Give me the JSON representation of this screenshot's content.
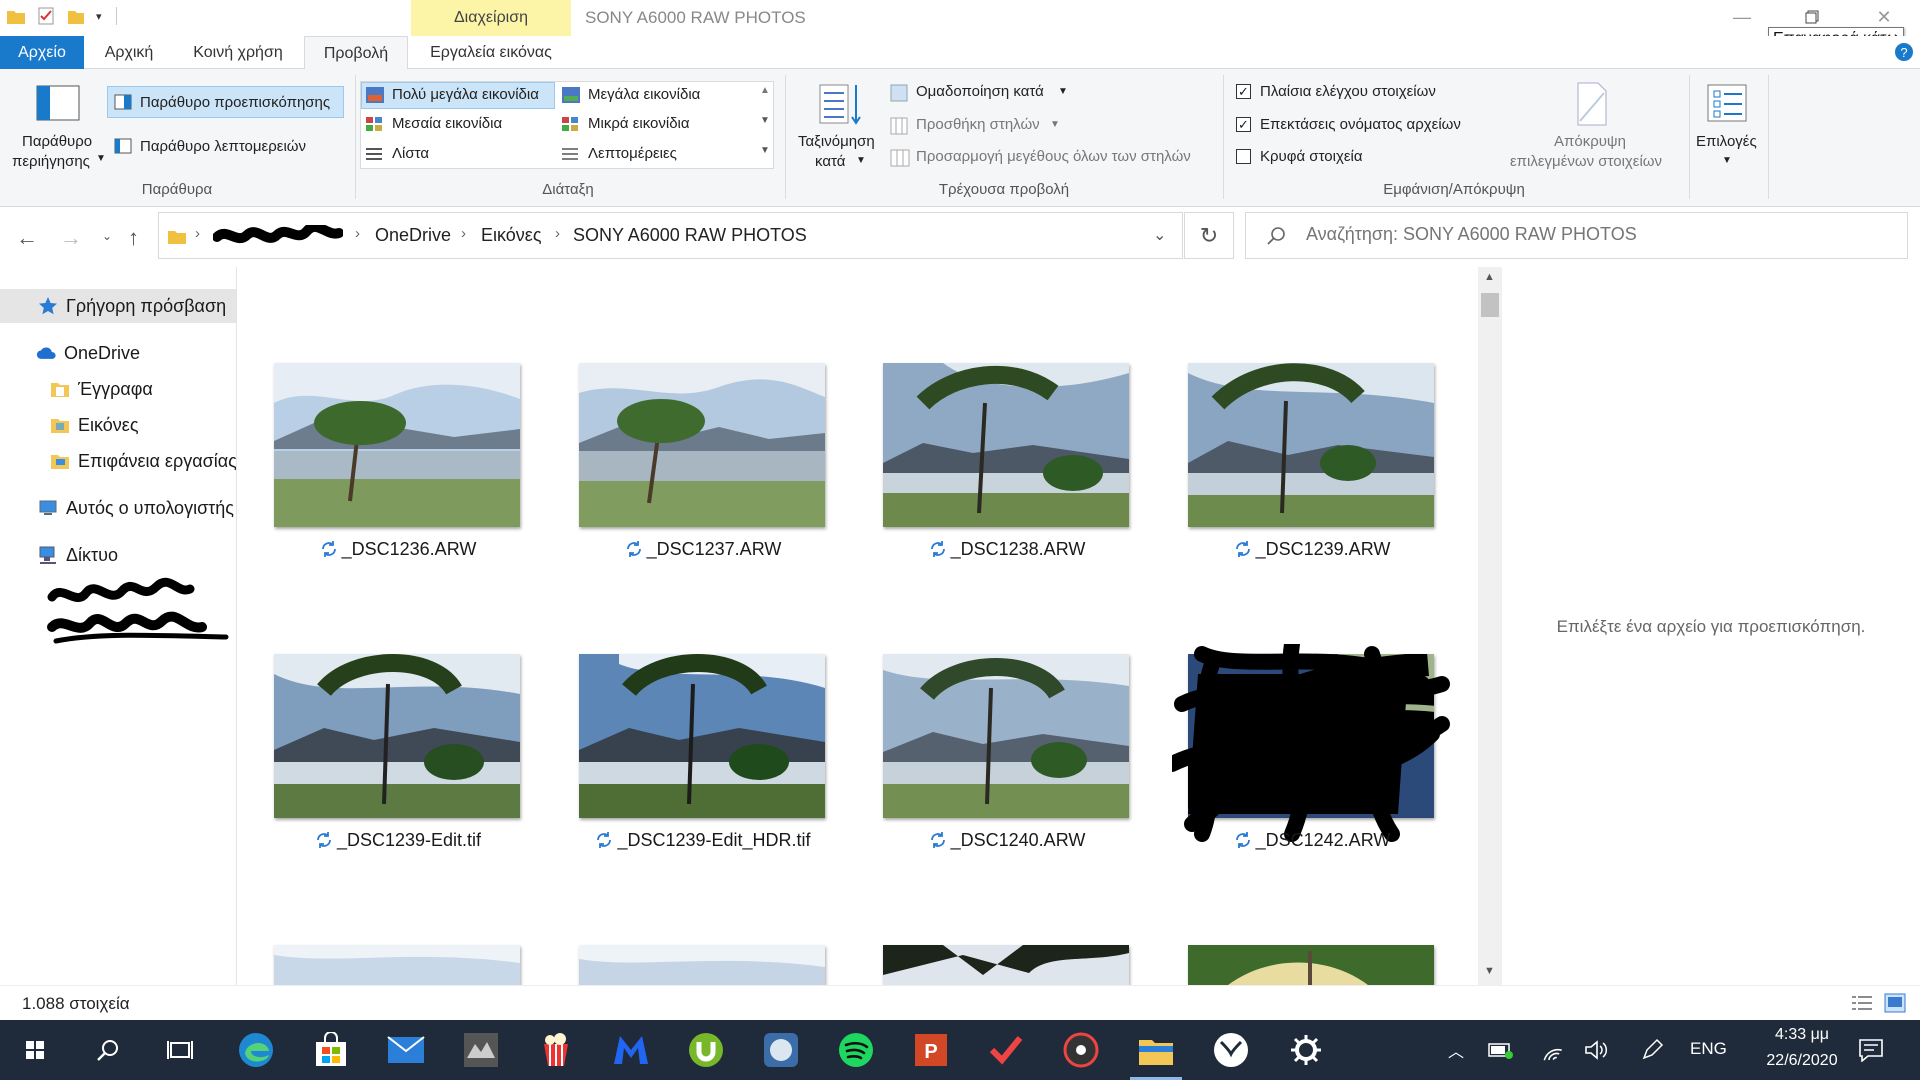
{
  "window": {
    "title": "SONY A6000 RAW PHOTOS",
    "context_tab_header": "Διαχείριση",
    "tooltip": "Επαναφορά κάτω"
  },
  "tabs": {
    "file": "Αρχείο",
    "home": "Αρχική",
    "share": "Κοινή χρήση",
    "view": "Προβολή",
    "image_tools": "Εργαλεία εικόνας"
  },
  "ribbon": {
    "panes": {
      "label": "Παράθυρα",
      "nav_pane": "Παράθυρο",
      "nav_pane_2": "περιήγησης",
      "preview_pane": "Παράθυρο προεπισκόπησης",
      "details_pane": "Παράθυρο λεπτομερειών"
    },
    "layout": {
      "label": "Διάταξη",
      "extra_large": "Πολύ μεγάλα εικονίδια",
      "large": "Μεγάλα εικονίδια",
      "medium": "Μεσαία εικονίδια",
      "small": "Μικρά εικονίδια",
      "list": "Λίστα",
      "details": "Λεπτομέρειες"
    },
    "current_view": {
      "label": "Τρέχουσα προβολή",
      "sort_by": "Ταξινόμηση",
      "sort_by_2": "κατά",
      "group_by": "Ομαδοποίηση κατά",
      "add_columns": "Προσθήκη στηλών",
      "size_columns": "Προσαρμογή μεγέθους όλων των στηλών"
    },
    "show_hide": {
      "label": "Εμφάνιση/Απόκρυψη",
      "item_checkboxes": "Πλαίσια ελέγχου στοιχείων",
      "file_extensions": "Επεκτάσεις ονόματος αρχείων",
      "hidden_items": "Κρυφά στοιχεία",
      "hide_selected": "Απόκρυψη",
      "hide_selected_2": "επιλεγμένων στοιχείων",
      "item_checkboxes_checked": true,
      "file_extensions_checked": true,
      "hidden_items_checked": false
    },
    "options": "Επιλογές"
  },
  "address": {
    "crumbs": [
      "OneDrive",
      "Εικόνες",
      "SONY A6000 RAW PHOTOS"
    ],
    "search_placeholder": "Αναζήτηση: SONY A6000 RAW PHOTOS"
  },
  "navpane": {
    "quick_access": "Γρήγορη πρόσβαση",
    "onedrive": "OneDrive",
    "documents": "Έγγραφα",
    "pictures": "Εικόνες",
    "desktop": "Επιφάνεια εργασίας",
    "this_pc": "Αυτός ο υπολογιστής",
    "network": "Δίκτυο"
  },
  "files": [
    {
      "name": "_DSC1236.ARW"
    },
    {
      "name": "_DSC1237.ARW"
    },
    {
      "name": "_DSC1238.ARW"
    },
    {
      "name": "_DSC1239.ARW"
    },
    {
      "name": "_DSC1239-Edit.tif"
    },
    {
      "name": "_DSC1239-Edit_HDR.tif"
    },
    {
      "name": "_DSC1240.ARW"
    },
    {
      "name": "_DSC1242.ARW"
    }
  ],
  "preview": {
    "message": "Επιλέξτε ένα αρχείο για προεπισκόπηση."
  },
  "status": {
    "count": "1.088 στοιχεία"
  },
  "taskbar": {
    "language": "ENG",
    "time": "4:33 μμ",
    "date": "22/6/2020"
  },
  "colors": {
    "accent": "#1979ca",
    "context_tab": "#fcf4a7",
    "taskbar": "#1f2b3a"
  }
}
